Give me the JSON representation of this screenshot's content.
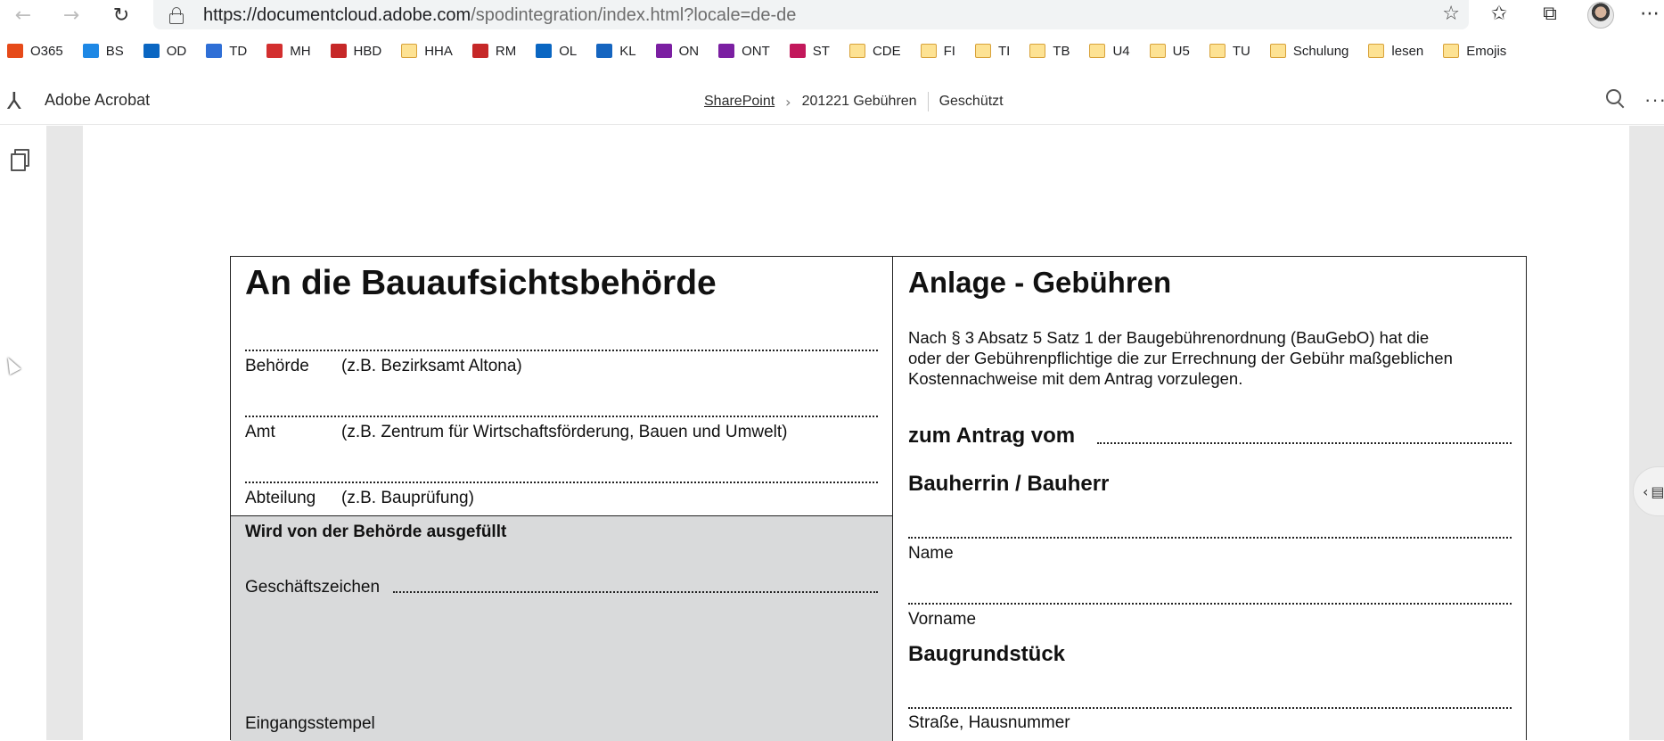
{
  "browser": {
    "url_host": "https://documentcloud.adobe.com",
    "url_path": "/spodintegration/index.html?locale=de-de",
    "back_icon": "back-arrow-icon",
    "forward_icon": "forward-arrow-icon",
    "reload_icon": "reload-icon"
  },
  "bookmarks": [
    {
      "label": "O365",
      "icon": "office-icon",
      "color": "#e64a19"
    },
    {
      "label": "BS",
      "icon": "bing-icon",
      "color": "#1e88e5"
    },
    {
      "label": "OD",
      "icon": "onedrive-icon",
      "color": "#0a66c2"
    },
    {
      "label": "TD",
      "icon": "todo-icon",
      "color": "#2f6fd6"
    },
    {
      "label": "MH",
      "icon": "mh-icon",
      "color": "#d32f2f"
    },
    {
      "label": "HBD",
      "icon": "hbd-icon",
      "color": "#c62828"
    },
    {
      "label": "HHA",
      "icon": "folder-icon",
      "color": "#fde293"
    },
    {
      "label": "RM",
      "icon": "rm-icon",
      "color": "#c62828"
    },
    {
      "label": "OL",
      "icon": "outlook-icon",
      "color": "#0a66c2"
    },
    {
      "label": "KL",
      "icon": "kl-icon",
      "color": "#1565c0"
    },
    {
      "label": "ON",
      "icon": "onenote-icon",
      "color": "#7b1fa2"
    },
    {
      "label": "ONT",
      "icon": "onenote-icon",
      "color": "#7b1fa2"
    },
    {
      "label": "ST",
      "icon": "stream-icon",
      "color": "#c2185b"
    },
    {
      "label": "CDE",
      "icon": "folder-icon",
      "color": "#fde293"
    },
    {
      "label": "FI",
      "icon": "folder-icon",
      "color": "#fde293"
    },
    {
      "label": "TI",
      "icon": "folder-icon",
      "color": "#fde293"
    },
    {
      "label": "TB",
      "icon": "folder-icon",
      "color": "#fde293"
    },
    {
      "label": "U4",
      "icon": "folder-icon",
      "color": "#fde293"
    },
    {
      "label": "U5",
      "icon": "folder-icon",
      "color": "#fde293"
    },
    {
      "label": "TU",
      "icon": "folder-icon",
      "color": "#fde293"
    },
    {
      "label": "Schulung",
      "icon": "folder-icon",
      "color": "#fde293"
    },
    {
      "label": "lesen",
      "icon": "folder-icon",
      "color": "#fde293"
    },
    {
      "label": "Emojis",
      "icon": "folder-icon",
      "color": "#fde293"
    }
  ],
  "acrobat": {
    "app_name": "Adobe Acrobat",
    "crumb_root": "SharePoint",
    "crumb_file": "201221 Gebühren",
    "crumb_status": "Geschützt",
    "more": "···"
  },
  "form": {
    "left_title": "An die Bauaufsichtsbehörde",
    "behoerde_label": "Behörde",
    "behoerde_hint": "(z.B. Bezirksamt Altona)",
    "amt_label": "Amt",
    "amt_hint": "(z.B. Zentrum für Wirtschaftsförderung, Bauen und Umwelt)",
    "abteilung_label": "Abteilung",
    "abteilung_hint": "(z.B. Bauprüfung)",
    "office_heading": "Wird von der Behörde ausgefüllt",
    "geschaeftszeichen_label": "Geschäftszeichen",
    "eingangsstempel_label": "Eingangsstempel",
    "right_title": "Anlage - Gebühren",
    "intro": "Nach § 3 Absatz 5 Satz 1 der Baugebührenordnung (BauGebO) hat die\noder der Gebührenpflichtige die zur Errechnung der Gebühr maßgeblichen\nKostennachweise mit dem Antrag vorzulegen.",
    "antrag_label": "zum Antrag vom",
    "bauherr_heading": "Bauherrin / Bauherr",
    "name_label": "Name",
    "vorname_label": "Vorname",
    "grundstueck_heading": "Baugrundstück",
    "strasse_label": "Straße, Hausnummer"
  }
}
